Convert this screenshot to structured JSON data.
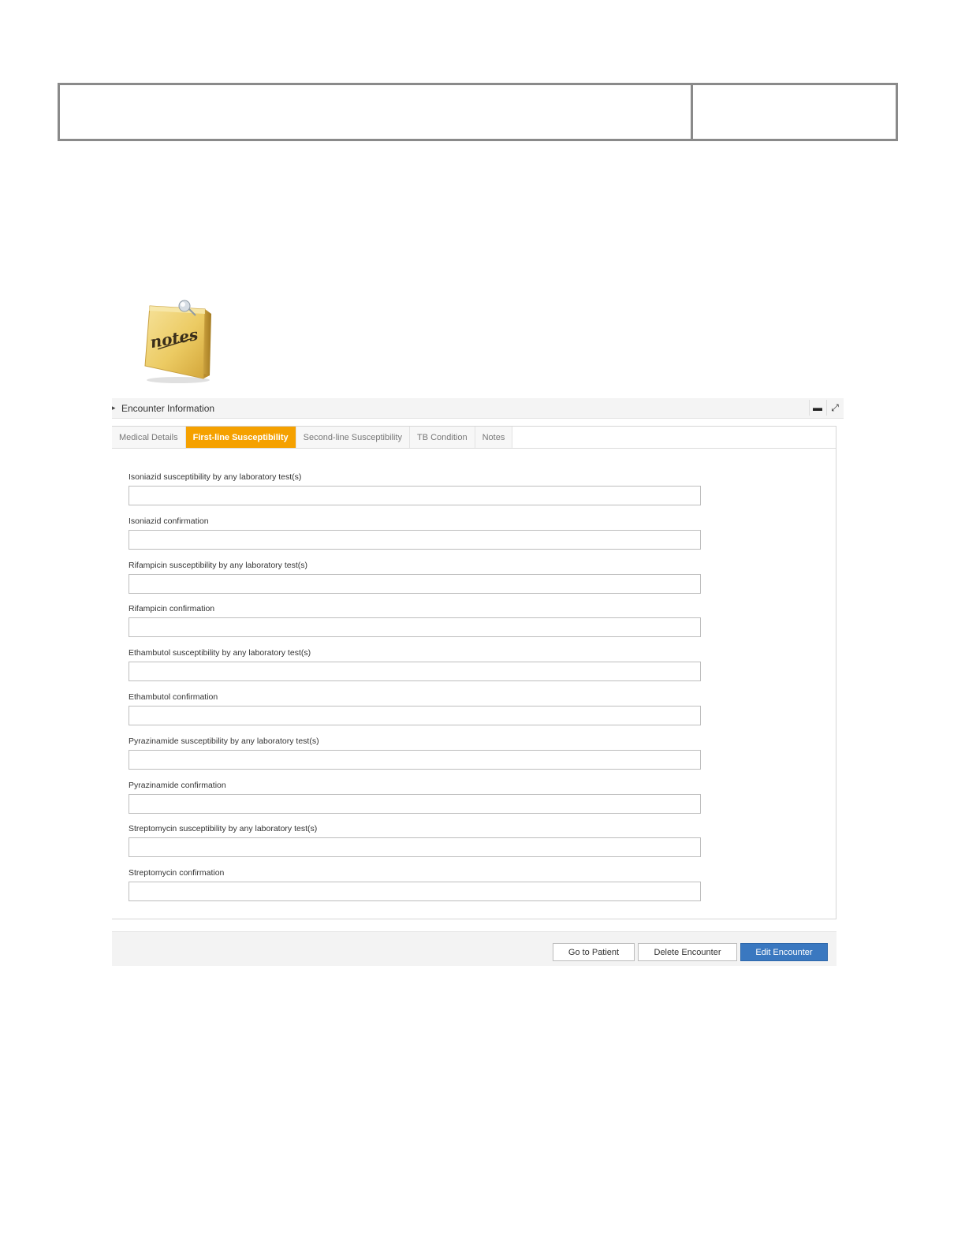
{
  "notes_image": {
    "caption": "notes",
    "icon": "sticky-note-icon"
  },
  "panel": {
    "title": "Encounter Information",
    "minimize_icon": "minus-icon",
    "maximize_icon": "expand-icon"
  },
  "tabs": [
    {
      "label": "Medical Details",
      "active": false
    },
    {
      "label": "First-line Susceptibility",
      "active": true
    },
    {
      "label": "Second-line Susceptibility",
      "active": false
    },
    {
      "label": "TB Condition",
      "active": false
    },
    {
      "label": "Notes",
      "active": false
    }
  ],
  "fields": [
    {
      "label": "Isoniazid susceptibility by any laboratory test(s)",
      "value": ""
    },
    {
      "label": "Isoniazid confirmation",
      "value": ""
    },
    {
      "label": "Rifampicin susceptibility by any laboratory test(s)",
      "value": ""
    },
    {
      "label": "Rifampicin confirmation",
      "value": ""
    },
    {
      "label": "Ethambutol susceptibility by any laboratory test(s)",
      "value": ""
    },
    {
      "label": "Ethambutol confirmation",
      "value": ""
    },
    {
      "label": "Pyrazinamide susceptibility by any laboratory test(s)",
      "value": ""
    },
    {
      "label": "Pyrazinamide confirmation",
      "value": ""
    },
    {
      "label": "Streptomycin susceptibility by any laboratory test(s)",
      "value": ""
    },
    {
      "label": "Streptomycin confirmation",
      "value": ""
    }
  ],
  "buttons": {
    "go_to_patient": "Go to Patient",
    "delete_encounter": "Delete Encounter",
    "edit_encounter": "Edit Encounter"
  },
  "colors": {
    "active_tab": "#f5a100",
    "primary_button": "#3a78c0"
  }
}
